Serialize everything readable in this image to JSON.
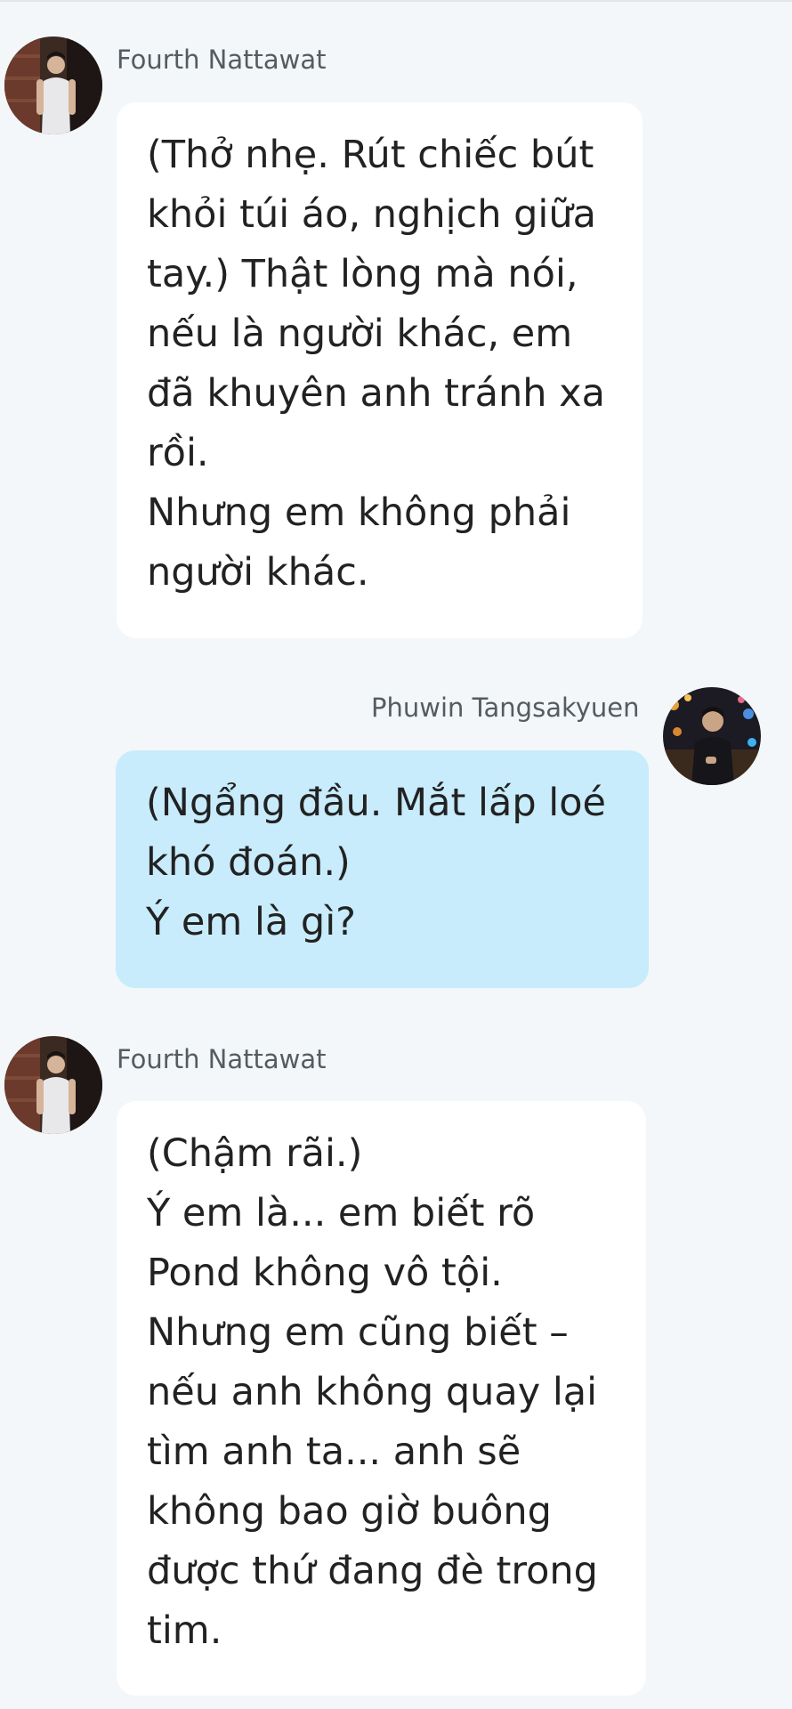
{
  "messages": [
    {
      "sender": "Fourth Nattawat",
      "avatar": "fourth-avatar",
      "side": "incoming",
      "text": "(Thở nhẹ. Rút chiếc bút khỏi túi áo, nghịch giữa tay.) Thật lòng mà nói, nếu là người khác, em đã khuyên anh tránh xa rồi.\nNhưng em không phải người khác."
    },
    {
      "sender": "Phuwin Tangsakyuen",
      "avatar": "phuwin-avatar",
      "side": "outgoing",
      "text": "(Ngẩng đầu. Mắt lấp loé khó đoán.)\nÝ em là gì?"
    },
    {
      "sender": "Fourth Nattawat",
      "avatar": "fourth-avatar",
      "side": "incoming",
      "text": "(Chậm rãi.)\nÝ em là... em biết rõ Pond không vô tội.\nNhưng em cũng biết – nếu anh không quay lại tìm anh ta... anh sẽ không bao giờ buông được thứ đang đè trong tim."
    }
  ],
  "colors": {
    "background": "#f3f7f9",
    "incoming_bubble": "#ffffff",
    "outgoing_bubble": "#c8ecfc",
    "sender_text": "#555c60"
  }
}
